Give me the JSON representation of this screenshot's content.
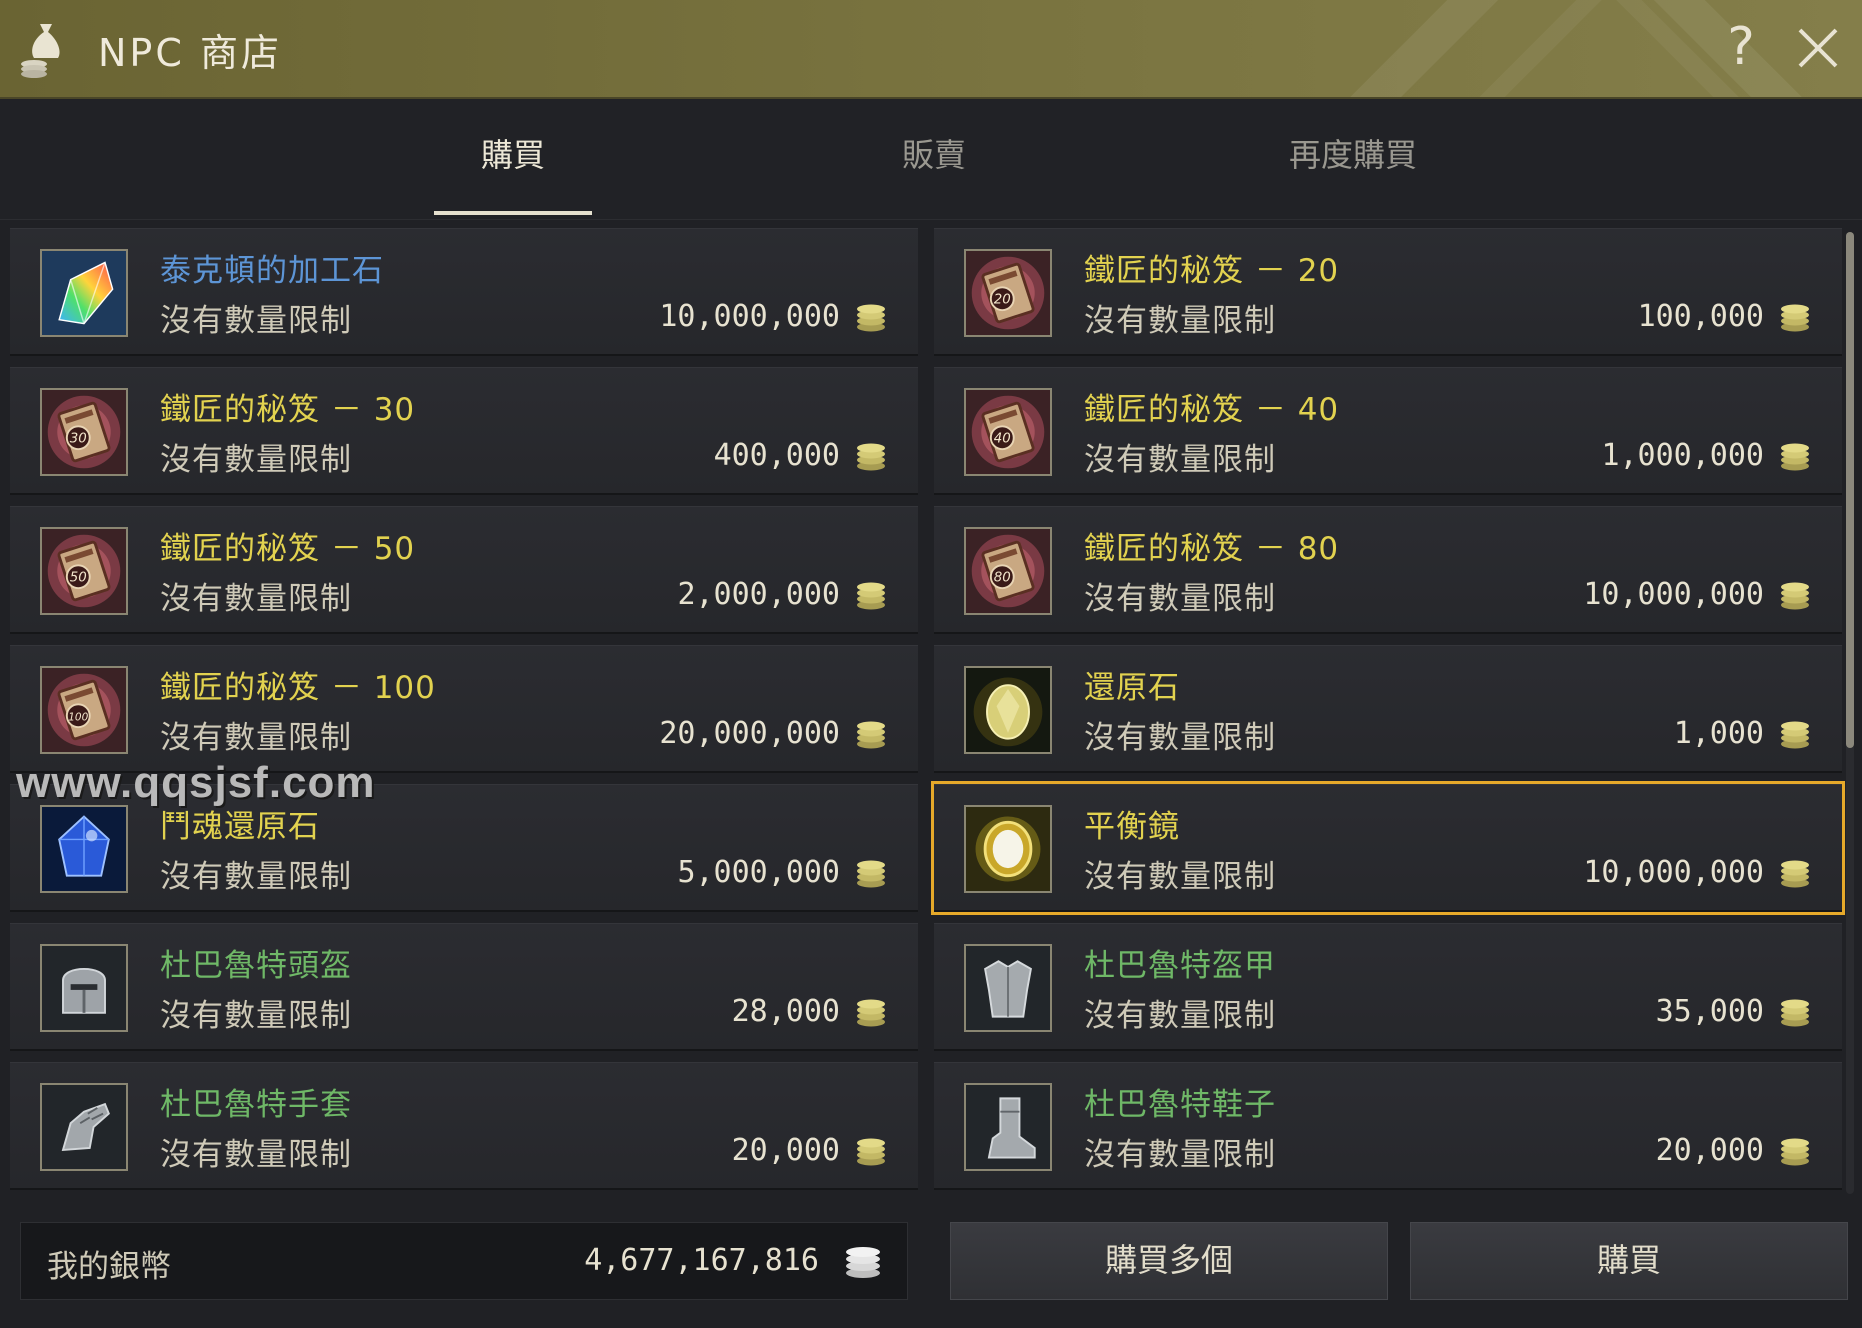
{
  "header": {
    "title": "NPC 商店",
    "help_label": "?"
  },
  "tabs": [
    {
      "label": "購買",
      "active": true
    },
    {
      "label": "販賣",
      "active": false
    },
    {
      "label": "再度購買",
      "active": false
    }
  ],
  "items": [
    {
      "name": "泰克頓的加工石",
      "name_color": "blue",
      "limit": "沒有數量限制",
      "price": "10,000,000",
      "icon": "rainbow-crystal-icon"
    },
    {
      "name": "鐵匠的秘笈 － 20",
      "name_color": "yellow",
      "limit": "沒有數量限制",
      "price": "100,000",
      "icon": "blacksmith-book-icon",
      "badge": "20"
    },
    {
      "name": "鐵匠的秘笈 － 30",
      "name_color": "yellow",
      "limit": "沒有數量限制",
      "price": "400,000",
      "icon": "blacksmith-book-icon",
      "badge": "30"
    },
    {
      "name": "鐵匠的秘笈 － 40",
      "name_color": "yellow",
      "limit": "沒有數量限制",
      "price": "1,000,000",
      "icon": "blacksmith-book-icon",
      "badge": "40"
    },
    {
      "name": "鐵匠的秘笈 － 50",
      "name_color": "yellow",
      "limit": "沒有數量限制",
      "price": "2,000,000",
      "icon": "blacksmith-book-icon",
      "badge": "50"
    },
    {
      "name": "鐵匠的秘笈 － 80",
      "name_color": "yellow",
      "limit": "沒有數量限制",
      "price": "10,000,000",
      "icon": "blacksmith-book-icon",
      "badge": "80"
    },
    {
      "name": "鐵匠的秘笈 － 100",
      "name_color": "yellow",
      "limit": "沒有數量限制",
      "price": "20,000,000",
      "icon": "blacksmith-book-icon",
      "badge": "100"
    },
    {
      "name": "還原石",
      "name_color": "yellow",
      "limit": "沒有數量限制",
      "price": "1,000",
      "icon": "restoration-stone-icon"
    },
    {
      "name": "鬥魂還原石",
      "name_color": "yellow",
      "limit": "沒有數量限制",
      "price": "5,000,000",
      "icon": "blue-crystal-icon"
    },
    {
      "name": "平衡鏡",
      "name_color": "yellow",
      "limit": "沒有數量限制",
      "price": "10,000,000",
      "icon": "balance-mirror-icon",
      "selected": true
    },
    {
      "name": "杜巴魯特頭盔",
      "name_color": "green",
      "limit": "沒有數量限制",
      "price": "28,000",
      "icon": "helmet-icon"
    },
    {
      "name": "杜巴魯特盔甲",
      "name_color": "green",
      "limit": "沒有數量限制",
      "price": "35,000",
      "icon": "armor-icon"
    },
    {
      "name": "杜巴魯特手套",
      "name_color": "green",
      "limit": "沒有數量限制",
      "price": "20,000",
      "icon": "gauntlet-icon"
    },
    {
      "name": "杜巴魯特鞋子",
      "name_color": "green",
      "limit": "沒有數量限制",
      "price": "20,000",
      "icon": "boots-icon"
    }
  ],
  "watermark": "www.qqsjsf.com",
  "footer": {
    "wallet_label": "我的銀幣",
    "wallet_amount": "4,677,167,816",
    "buy_multiple_label": "購買多個",
    "buy_label": "購買"
  },
  "colors": {
    "accent_selected": "#e6a92a",
    "name_blue": "#5d95d6",
    "name_yellow": "#e2d24f",
    "name_green": "#6fb867"
  }
}
